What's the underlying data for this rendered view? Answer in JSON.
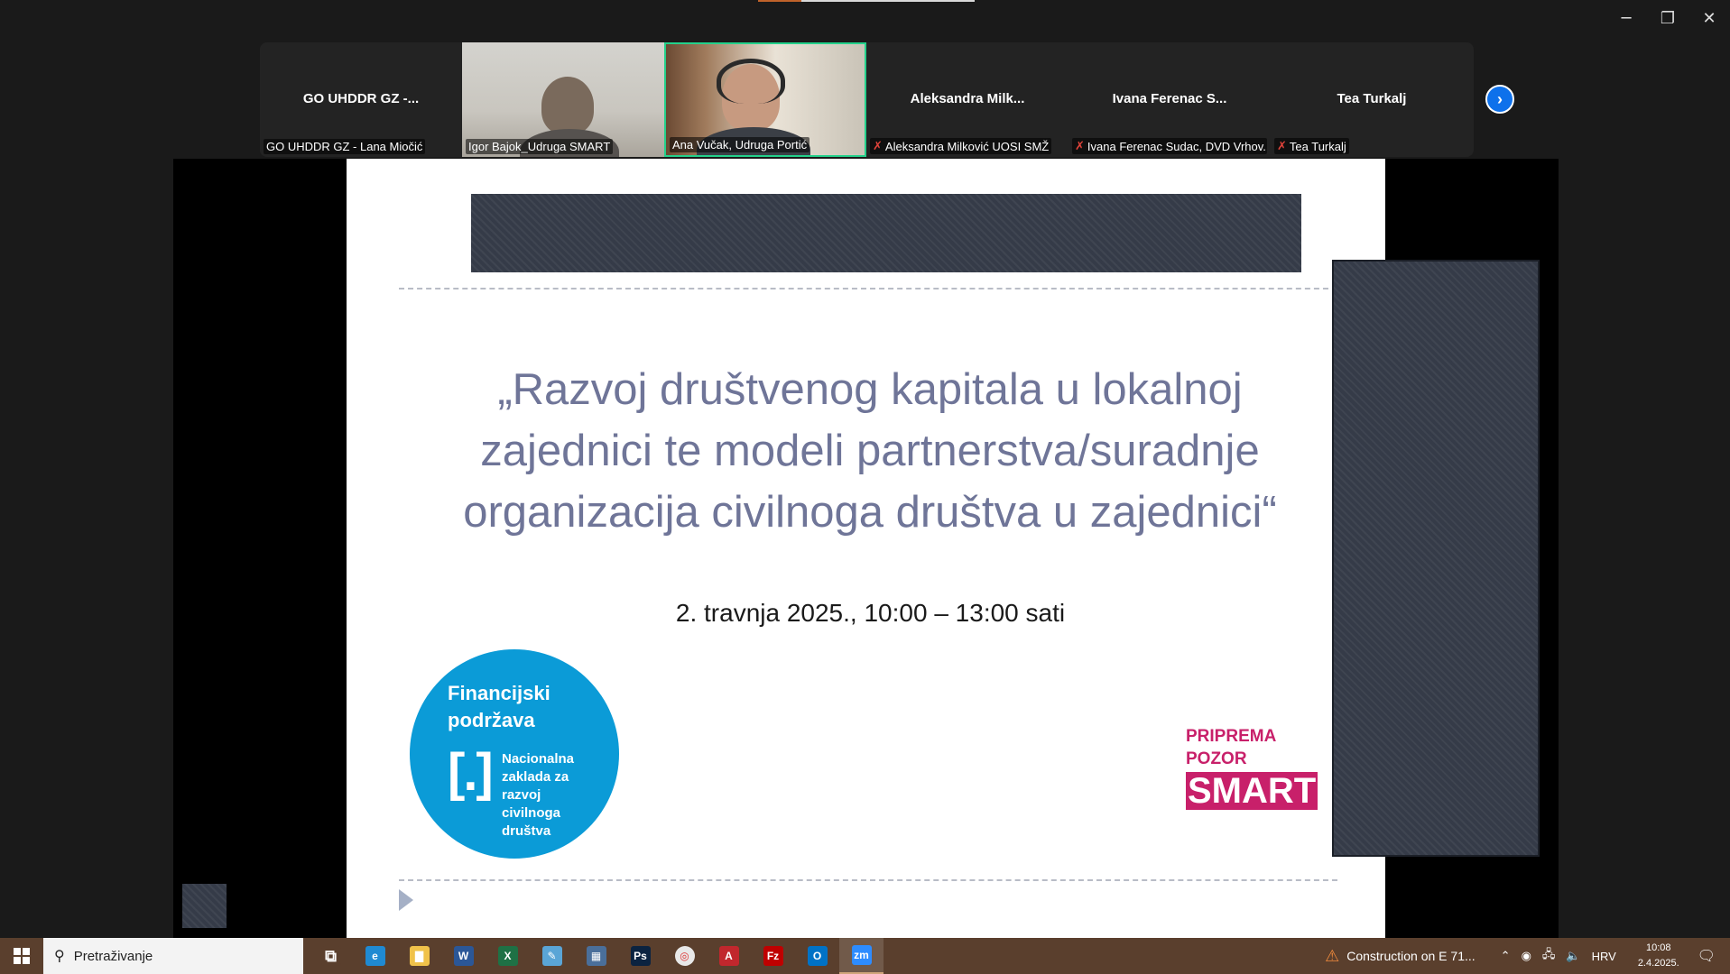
{
  "window": {
    "controls": {
      "minimize": "─",
      "restore": "❐",
      "close": "✕"
    }
  },
  "participants": [
    {
      "big_name": "GO UHDDR GZ -...",
      "label": "GO UHDDR GZ - Lana Miočić",
      "muted": false,
      "video": false
    },
    {
      "big_name": "",
      "label": "Igor Bajok_Udruga SMART",
      "muted": false,
      "video": true
    },
    {
      "big_name": "",
      "label": "Ana Vučak, Udruga Portić",
      "muted": false,
      "video": true,
      "active_speaker": true
    },
    {
      "big_name": "Aleksandra  Milk...",
      "label": "Aleksandra Milković UOSI SMŽ",
      "muted": true,
      "video": false
    },
    {
      "big_name": "Ivana  Ferenac S...",
      "label": "Ivana Ferenac Sudac, DVD Vrhov...",
      "muted": true,
      "video": false
    },
    {
      "big_name": "Tea Turkalj",
      "label": "Tea Turkalj",
      "muted": true,
      "video": false
    }
  ],
  "slide": {
    "title_lines": [
      "„Razvoj društvenog kapitala u lokalnoj",
      "zajednici te modeli partnerstva/suradnje",
      "organizacija civilnoga društva u zajednici“"
    ],
    "date": "2. travnja 2025., 10:00 – 13:00 sati",
    "fin_logo": {
      "line1": "Financijski",
      "line2": "podržava",
      "bracket": "[.]",
      "org_lines": [
        "Nacionalna",
        "zaklada za",
        "razvoj",
        "civilnoga",
        "društva"
      ]
    },
    "smart_logo": {
      "line1": "PRIPREMA",
      "line2": "POZOR",
      "line3": "SMART"
    }
  },
  "taskbar": {
    "search_placeholder": "Pretraživanje",
    "apps": [
      {
        "name": "task-view",
        "glyph": "⧉",
        "color": "#5a3f2d"
      },
      {
        "name": "edge",
        "glyph": "e",
        "color": "#1f8ad2"
      },
      {
        "name": "file-explorer",
        "glyph": "▇",
        "color": "#f0c24a"
      },
      {
        "name": "word",
        "glyph": "W",
        "color": "#2b5797"
      },
      {
        "name": "excel",
        "glyph": "X",
        "color": "#1e7145"
      },
      {
        "name": "notes",
        "glyph": "✎",
        "color": "#5aa5d6"
      },
      {
        "name": "calculator",
        "glyph": "▦",
        "color": "#4a6f9a"
      },
      {
        "name": "photoshop",
        "glyph": "Ps",
        "color": "#0b2340"
      },
      {
        "name": "chrome-like",
        "glyph": "◎",
        "color": "#e8e8e8"
      },
      {
        "name": "acrobat",
        "glyph": "A",
        "color": "#c1272d"
      },
      {
        "name": "filezilla",
        "glyph": "Fz",
        "color": "#bf0000"
      },
      {
        "name": "outlook",
        "glyph": "O",
        "color": "#0072c6"
      },
      {
        "name": "zoom",
        "glyph": "zm",
        "color": "#2d8cff"
      }
    ],
    "news": "Construction on E 71...",
    "language": "HRV",
    "time": "10:08",
    "date": "2.4.2025."
  },
  "colors": {
    "accent_blue": "#0e71eb",
    "active_speaker_border": "#23d18b",
    "slide_title": "#6f7598",
    "fin_logo_blue": "#0b9bd7",
    "smart_magenta": "#c8206a",
    "taskbar": "#5a3f2d"
  }
}
